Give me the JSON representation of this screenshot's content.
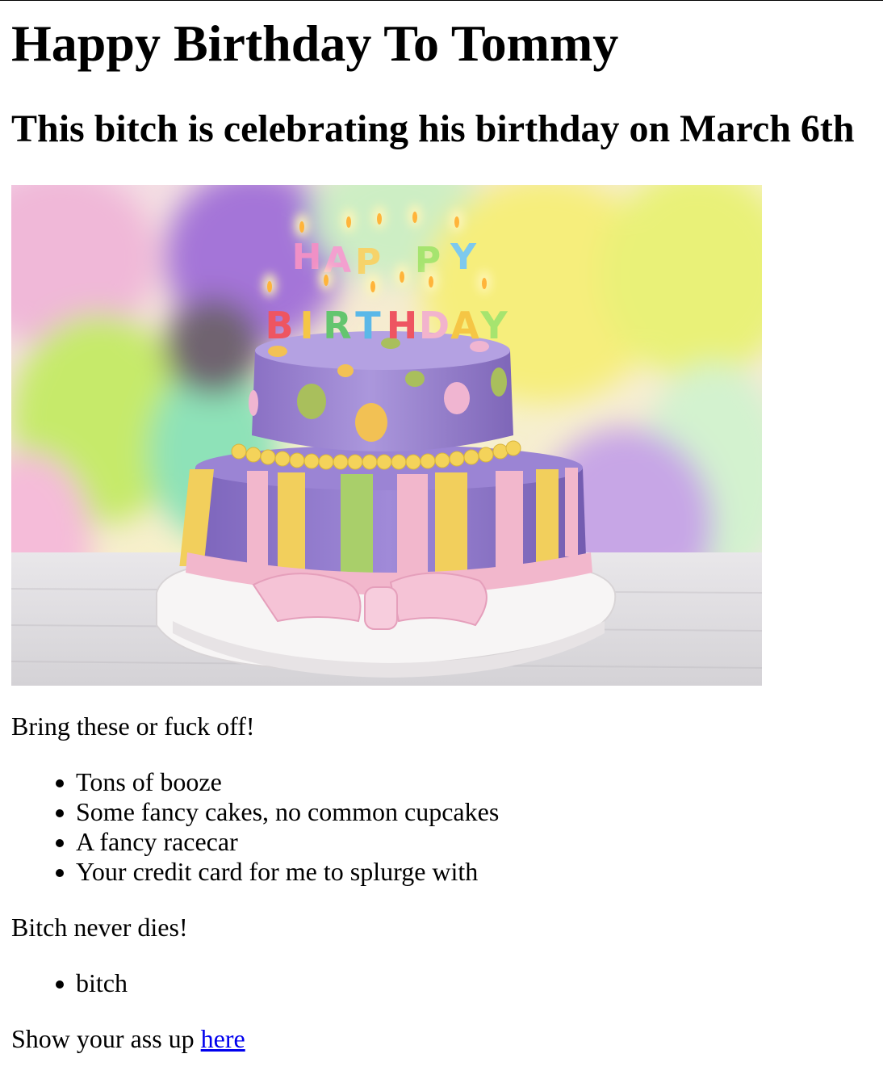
{
  "heading": "Happy Birthday To Tommy",
  "subheading": "This bitch is celebrating his birthday on March 6th",
  "hero_image": {
    "candle_letters_top": [
      "H",
      "A",
      "P",
      "P",
      "Y"
    ],
    "candle_letters_bottom": [
      "B",
      "I",
      "R",
      "T",
      "H",
      "D",
      "A",
      "Y"
    ]
  },
  "intro": "Bring these or fuck off!",
  "bring_list": [
    "Tons of booze",
    "Some fancy cakes, no common cupcakes",
    "A fancy racecar",
    "Your credit card for me to splurge with"
  ],
  "motto": "Bitch never dies!",
  "motto_list": [
    "bitch"
  ],
  "rsvp": {
    "prefix": "Show your ass up ",
    "link_text": "here"
  },
  "colors": {
    "link": "#0000ee",
    "cake_purple": "#9a84d0",
    "fondant_pink": "#f2b7cc",
    "fondant_yellow": "#f2cf5c",
    "fondant_green": "#a9cf6a"
  }
}
